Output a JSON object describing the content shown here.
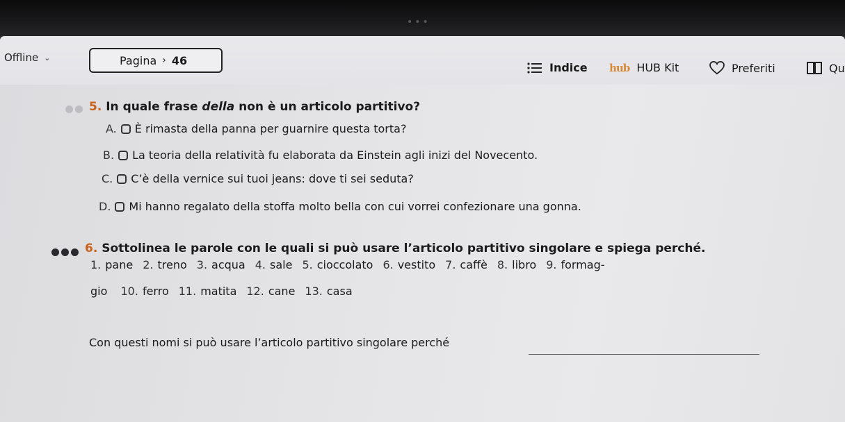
{
  "toolbar": {
    "status": "Offline",
    "page_label": "Pagina",
    "page_number": "46",
    "indice_label": "Indice",
    "hub_logo": "hub",
    "hub_kit_label": "HUB Kit",
    "preferiti_label": "Preferiti",
    "last_label": "Qu"
  },
  "exercise5": {
    "number": "5.",
    "question_pre": "In quale frase ",
    "question_italic": "della",
    "question_post": " non è un articolo partitivo?",
    "options": [
      {
        "letter": "A.",
        "text": "È rimasta della panna per guarnire questa torta?"
      },
      {
        "letter": "B.",
        "text": "La teoria della relatività fu elaborata da Einstein agli inizi del Novecento."
      },
      {
        "letter": "C.",
        "text": "C’è della vernice sui tuoi jeans: dove ti sei seduta?"
      },
      {
        "letter": "D.",
        "text": "Mi hanno regalato della stoffa molto bella con cui vorrei confezionare una gonna."
      }
    ]
  },
  "exercise6": {
    "number": "6.",
    "question": "Sottolinea le parole con le quali si può usare l’articolo partitivo singolare e spiega perché.",
    "line1": [
      {
        "n": "1.",
        "w": "pane"
      },
      {
        "n": "2.",
        "w": "treno"
      },
      {
        "n": "3.",
        "w": "acqua"
      },
      {
        "n": "4.",
        "w": "sale"
      },
      {
        "n": "5.",
        "w": "cioccolato"
      },
      {
        "n": "6.",
        "w": "vestito"
      },
      {
        "n": "7.",
        "w": "caffè"
      },
      {
        "n": "8.",
        "w": "libro"
      },
      {
        "n": "9.",
        "w": "formag-"
      }
    ],
    "line2_prefix": "gio",
    "line2": [
      {
        "n": "10.",
        "w": "ferro"
      },
      {
        "n": "11.",
        "w": "matita"
      },
      {
        "n": "12.",
        "w": "cane"
      },
      {
        "n": "13.",
        "w": "casa"
      }
    ],
    "answer_prompt": "Con questi nomi si può usare l’articolo partitivo singolare perché"
  },
  "colors": {
    "accent": "#c8611a",
    "dot_light": "#bdbdc2",
    "dot_dark": "#2a2a2e"
  }
}
